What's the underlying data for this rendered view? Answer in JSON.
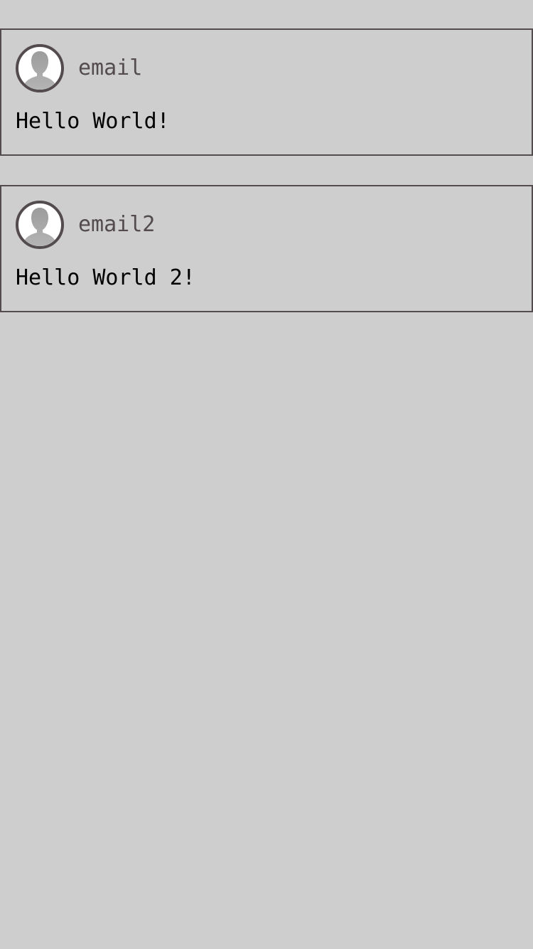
{
  "colors": {
    "background": "#cecece",
    "border": "#534b4d",
    "author_text": "#534b4d",
    "body_text": "#000000",
    "avatar_bg": "#ffffff",
    "avatar_silhouette": "#a8a8a8"
  },
  "posts": [
    {
      "author": "email",
      "avatar_icon": "user-silhouette-icon",
      "message": "Hello World!"
    },
    {
      "author": "email2",
      "avatar_icon": "user-silhouette-icon",
      "message": "Hello World 2!"
    }
  ]
}
